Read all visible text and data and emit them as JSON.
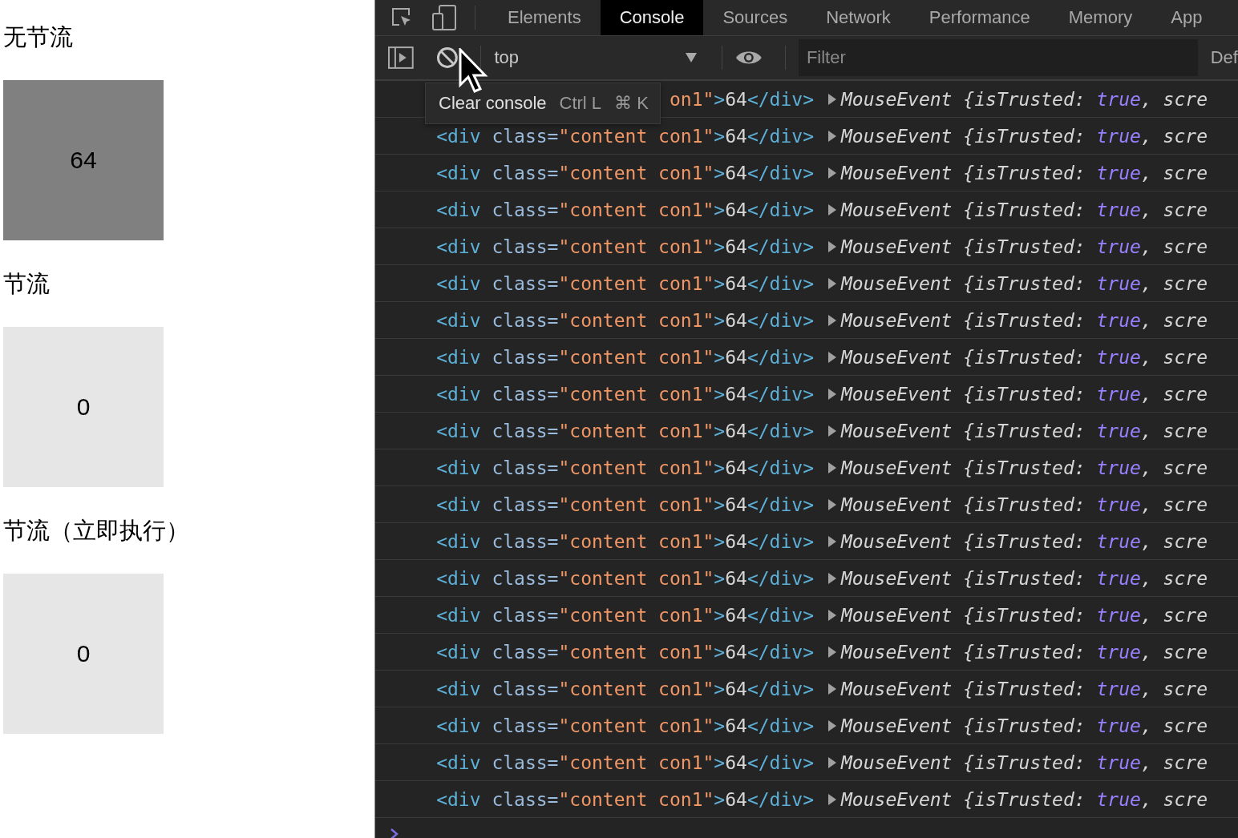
{
  "page": {
    "sections": [
      {
        "heading": "无节流",
        "value": "64",
        "hovered": true
      },
      {
        "heading": "节流",
        "value": "0",
        "hovered": false
      },
      {
        "heading": "节流（立即执行）",
        "value": "0",
        "hovered": false
      }
    ]
  },
  "devtools": {
    "tabs": [
      {
        "label": "Elements",
        "selected": false
      },
      {
        "label": "Console",
        "selected": true
      },
      {
        "label": "Sources",
        "selected": false
      },
      {
        "label": "Network",
        "selected": false
      },
      {
        "label": "Performance",
        "selected": false
      },
      {
        "label": "Memory",
        "selected": false
      },
      {
        "label": "App",
        "selected": false
      }
    ],
    "toolbar": {
      "context": "top",
      "filter_placeholder": "Filter",
      "levels": "Def"
    },
    "tooltip": {
      "label": "Clear console",
      "shortcut_1": "Ctrl L",
      "shortcut_2": "⌘ K"
    },
    "logs": [
      {
        "element": [
          {
            "kind": "string",
            "text": "on1\""
          },
          {
            "kind": "tag",
            "text": ">"
          },
          {
            "kind": "text",
            "text": "64"
          },
          {
            "kind": "tag",
            "text": "</div>"
          }
        ],
        "object": [
          {
            "kind": "plain",
            "text": "MouseEvent {isTrusted: "
          },
          {
            "kind": "keyword",
            "text": "true"
          },
          {
            "kind": "plain",
            "text": ", scre"
          }
        ]
      },
      {
        "element": [
          {
            "kind": "tag",
            "text": "<div "
          },
          {
            "kind": "attr",
            "text": "class="
          },
          {
            "kind": "string",
            "text": "\"content con1\""
          },
          {
            "kind": "tag",
            "text": ">"
          },
          {
            "kind": "text",
            "text": "64"
          },
          {
            "kind": "tag",
            "text": "</div>"
          }
        ],
        "object": [
          {
            "kind": "plain",
            "text": "MouseEvent {isTrusted: "
          },
          {
            "kind": "keyword",
            "text": "true"
          },
          {
            "kind": "plain",
            "text": ", scre"
          }
        ]
      },
      {
        "element": [
          {
            "kind": "tag",
            "text": "<div "
          },
          {
            "kind": "attr",
            "text": "class="
          },
          {
            "kind": "string",
            "text": "\"content con1\""
          },
          {
            "kind": "tag",
            "text": ">"
          },
          {
            "kind": "text",
            "text": "64"
          },
          {
            "kind": "tag",
            "text": "</div>"
          }
        ],
        "object": [
          {
            "kind": "plain",
            "text": "MouseEvent {isTrusted: "
          },
          {
            "kind": "keyword",
            "text": "true"
          },
          {
            "kind": "plain",
            "text": ", scre"
          }
        ]
      },
      {
        "element": [
          {
            "kind": "tag",
            "text": "<div "
          },
          {
            "kind": "attr",
            "text": "class="
          },
          {
            "kind": "string",
            "text": "\"content con1\""
          },
          {
            "kind": "tag",
            "text": ">"
          },
          {
            "kind": "text",
            "text": "64"
          },
          {
            "kind": "tag",
            "text": "</div>"
          }
        ],
        "object": [
          {
            "kind": "plain",
            "text": "MouseEvent {isTrusted: "
          },
          {
            "kind": "keyword",
            "text": "true"
          },
          {
            "kind": "plain",
            "text": ", scre"
          }
        ]
      },
      {
        "element": [
          {
            "kind": "tag",
            "text": "<div "
          },
          {
            "kind": "attr",
            "text": "class="
          },
          {
            "kind": "string",
            "text": "\"content con1\""
          },
          {
            "kind": "tag",
            "text": ">"
          },
          {
            "kind": "text",
            "text": "64"
          },
          {
            "kind": "tag",
            "text": "</div>"
          }
        ],
        "object": [
          {
            "kind": "plain",
            "text": "MouseEvent {isTrusted: "
          },
          {
            "kind": "keyword",
            "text": "true"
          },
          {
            "kind": "plain",
            "text": ", scre"
          }
        ]
      },
      {
        "element": [
          {
            "kind": "tag",
            "text": "<div "
          },
          {
            "kind": "attr",
            "text": "class="
          },
          {
            "kind": "string",
            "text": "\"content con1\""
          },
          {
            "kind": "tag",
            "text": ">"
          },
          {
            "kind": "text",
            "text": "64"
          },
          {
            "kind": "tag",
            "text": "</div>"
          }
        ],
        "object": [
          {
            "kind": "plain",
            "text": "MouseEvent {isTrusted: "
          },
          {
            "kind": "keyword",
            "text": "true"
          },
          {
            "kind": "plain",
            "text": ", scre"
          }
        ]
      },
      {
        "element": [
          {
            "kind": "tag",
            "text": "<div "
          },
          {
            "kind": "attr",
            "text": "class="
          },
          {
            "kind": "string",
            "text": "\"content con1\""
          },
          {
            "kind": "tag",
            "text": ">"
          },
          {
            "kind": "text",
            "text": "64"
          },
          {
            "kind": "tag",
            "text": "</div>"
          }
        ],
        "object": [
          {
            "kind": "plain",
            "text": "MouseEvent {isTrusted: "
          },
          {
            "kind": "keyword",
            "text": "true"
          },
          {
            "kind": "plain",
            "text": ", scre"
          }
        ]
      },
      {
        "element": [
          {
            "kind": "tag",
            "text": "<div "
          },
          {
            "kind": "attr",
            "text": "class="
          },
          {
            "kind": "string",
            "text": "\"content con1\""
          },
          {
            "kind": "tag",
            "text": ">"
          },
          {
            "kind": "text",
            "text": "64"
          },
          {
            "kind": "tag",
            "text": "</div>"
          }
        ],
        "object": [
          {
            "kind": "plain",
            "text": "MouseEvent {isTrusted: "
          },
          {
            "kind": "keyword",
            "text": "true"
          },
          {
            "kind": "plain",
            "text": ", scre"
          }
        ]
      },
      {
        "element": [
          {
            "kind": "tag",
            "text": "<div "
          },
          {
            "kind": "attr",
            "text": "class="
          },
          {
            "kind": "string",
            "text": "\"content con1\""
          },
          {
            "kind": "tag",
            "text": ">"
          },
          {
            "kind": "text",
            "text": "64"
          },
          {
            "kind": "tag",
            "text": "</div>"
          }
        ],
        "object": [
          {
            "kind": "plain",
            "text": "MouseEvent {isTrusted: "
          },
          {
            "kind": "keyword",
            "text": "true"
          },
          {
            "kind": "plain",
            "text": ", scre"
          }
        ]
      },
      {
        "element": [
          {
            "kind": "tag",
            "text": "<div "
          },
          {
            "kind": "attr",
            "text": "class="
          },
          {
            "kind": "string",
            "text": "\"content con1\""
          },
          {
            "kind": "tag",
            "text": ">"
          },
          {
            "kind": "text",
            "text": "64"
          },
          {
            "kind": "tag",
            "text": "</div>"
          }
        ],
        "object": [
          {
            "kind": "plain",
            "text": "MouseEvent {isTrusted: "
          },
          {
            "kind": "keyword",
            "text": "true"
          },
          {
            "kind": "plain",
            "text": ", scre"
          }
        ]
      },
      {
        "element": [
          {
            "kind": "tag",
            "text": "<div "
          },
          {
            "kind": "attr",
            "text": "class="
          },
          {
            "kind": "string",
            "text": "\"content con1\""
          },
          {
            "kind": "tag",
            "text": ">"
          },
          {
            "kind": "text",
            "text": "64"
          },
          {
            "kind": "tag",
            "text": "</div>"
          }
        ],
        "object": [
          {
            "kind": "plain",
            "text": "MouseEvent {isTrusted: "
          },
          {
            "kind": "keyword",
            "text": "true"
          },
          {
            "kind": "plain",
            "text": ", scre"
          }
        ]
      },
      {
        "element": [
          {
            "kind": "tag",
            "text": "<div "
          },
          {
            "kind": "attr",
            "text": "class="
          },
          {
            "kind": "string",
            "text": "\"content con1\""
          },
          {
            "kind": "tag",
            "text": ">"
          },
          {
            "kind": "text",
            "text": "64"
          },
          {
            "kind": "tag",
            "text": "</div>"
          }
        ],
        "object": [
          {
            "kind": "plain",
            "text": "MouseEvent {isTrusted: "
          },
          {
            "kind": "keyword",
            "text": "true"
          },
          {
            "kind": "plain",
            "text": ", scre"
          }
        ]
      },
      {
        "element": [
          {
            "kind": "tag",
            "text": "<div "
          },
          {
            "kind": "attr",
            "text": "class="
          },
          {
            "kind": "string",
            "text": "\"content con1\""
          },
          {
            "kind": "tag",
            "text": ">"
          },
          {
            "kind": "text",
            "text": "64"
          },
          {
            "kind": "tag",
            "text": "</div>"
          }
        ],
        "object": [
          {
            "kind": "plain",
            "text": "MouseEvent {isTrusted: "
          },
          {
            "kind": "keyword",
            "text": "true"
          },
          {
            "kind": "plain",
            "text": ", scre"
          }
        ]
      },
      {
        "element": [
          {
            "kind": "tag",
            "text": "<div "
          },
          {
            "kind": "attr",
            "text": "class="
          },
          {
            "kind": "string",
            "text": "\"content con1\""
          },
          {
            "kind": "tag",
            "text": ">"
          },
          {
            "kind": "text",
            "text": "64"
          },
          {
            "kind": "tag",
            "text": "</div>"
          }
        ],
        "object": [
          {
            "kind": "plain",
            "text": "MouseEvent {isTrusted: "
          },
          {
            "kind": "keyword",
            "text": "true"
          },
          {
            "kind": "plain",
            "text": ", scre"
          }
        ]
      },
      {
        "element": [
          {
            "kind": "tag",
            "text": "<div "
          },
          {
            "kind": "attr",
            "text": "class="
          },
          {
            "kind": "string",
            "text": "\"content con1\""
          },
          {
            "kind": "tag",
            "text": ">"
          },
          {
            "kind": "text",
            "text": "64"
          },
          {
            "kind": "tag",
            "text": "</div>"
          }
        ],
        "object": [
          {
            "kind": "plain",
            "text": "MouseEvent {isTrusted: "
          },
          {
            "kind": "keyword",
            "text": "true"
          },
          {
            "kind": "plain",
            "text": ", scre"
          }
        ]
      },
      {
        "element": [
          {
            "kind": "tag",
            "text": "<div "
          },
          {
            "kind": "attr",
            "text": "class="
          },
          {
            "kind": "string",
            "text": "\"content con1\""
          },
          {
            "kind": "tag",
            "text": ">"
          },
          {
            "kind": "text",
            "text": "64"
          },
          {
            "kind": "tag",
            "text": "</div>"
          }
        ],
        "object": [
          {
            "kind": "plain",
            "text": "MouseEvent {isTrusted: "
          },
          {
            "kind": "keyword",
            "text": "true"
          },
          {
            "kind": "plain",
            "text": ", scre"
          }
        ]
      },
      {
        "element": [
          {
            "kind": "tag",
            "text": "<div "
          },
          {
            "kind": "attr",
            "text": "class="
          },
          {
            "kind": "string",
            "text": "\"content con1\""
          },
          {
            "kind": "tag",
            "text": ">"
          },
          {
            "kind": "text",
            "text": "64"
          },
          {
            "kind": "tag",
            "text": "</div>"
          }
        ],
        "object": [
          {
            "kind": "plain",
            "text": "MouseEvent {isTrusted: "
          },
          {
            "kind": "keyword",
            "text": "true"
          },
          {
            "kind": "plain",
            "text": ", scre"
          }
        ]
      },
      {
        "element": [
          {
            "kind": "tag",
            "text": "<div "
          },
          {
            "kind": "attr",
            "text": "class="
          },
          {
            "kind": "string",
            "text": "\"content con1\""
          },
          {
            "kind": "tag",
            "text": ">"
          },
          {
            "kind": "text",
            "text": "64"
          },
          {
            "kind": "tag",
            "text": "</div>"
          }
        ],
        "object": [
          {
            "kind": "plain",
            "text": "MouseEvent {isTrusted: "
          },
          {
            "kind": "keyword",
            "text": "true"
          },
          {
            "kind": "plain",
            "text": ", scre"
          }
        ]
      },
      {
        "element": [
          {
            "kind": "tag",
            "text": "<div "
          },
          {
            "kind": "attr",
            "text": "class="
          },
          {
            "kind": "string",
            "text": "\"content con1\""
          },
          {
            "kind": "tag",
            "text": ">"
          },
          {
            "kind": "text",
            "text": "64"
          },
          {
            "kind": "tag",
            "text": "</div>"
          }
        ],
        "object": [
          {
            "kind": "plain",
            "text": "MouseEvent {isTrusted: "
          },
          {
            "kind": "keyword",
            "text": "true"
          },
          {
            "kind": "plain",
            "text": ", scre"
          }
        ]
      },
      {
        "element": [
          {
            "kind": "tag",
            "text": "<div "
          },
          {
            "kind": "attr",
            "text": "class="
          },
          {
            "kind": "string",
            "text": "\"content con1\""
          },
          {
            "kind": "tag",
            "text": ">"
          },
          {
            "kind": "text",
            "text": "64"
          },
          {
            "kind": "tag",
            "text": "</div>"
          }
        ],
        "object": [
          {
            "kind": "plain",
            "text": "MouseEvent {isTrusted: "
          },
          {
            "kind": "keyword",
            "text": "true"
          },
          {
            "kind": "plain",
            "text": ", scre"
          }
        ]
      }
    ]
  }
}
